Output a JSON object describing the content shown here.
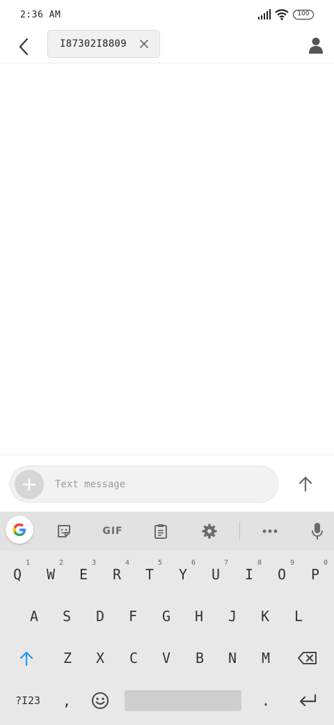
{
  "status_bar": {
    "time": "2:36 AM",
    "battery": "100"
  },
  "header": {
    "recipient": "I87302I8809"
  },
  "compose": {
    "placeholder": "Text message"
  },
  "keyboard": {
    "toolbar": {
      "gif_label": "GIF"
    },
    "row1": [
      {
        "label": "Q",
        "hint": "1"
      },
      {
        "label": "W",
        "hint": "2"
      },
      {
        "label": "E",
        "hint": "3"
      },
      {
        "label": "R",
        "hint": "4"
      },
      {
        "label": "T",
        "hint": "5"
      },
      {
        "label": "Y",
        "hint": "6"
      },
      {
        "label": "U",
        "hint": "7"
      },
      {
        "label": "I",
        "hint": "8"
      },
      {
        "label": "O",
        "hint": "9"
      },
      {
        "label": "P",
        "hint": "0"
      }
    ],
    "row2": [
      "A",
      "S",
      "D",
      "F",
      "G",
      "H",
      "J",
      "K",
      "L"
    ],
    "row3": [
      "Z",
      "X",
      "C",
      "V",
      "B",
      "N",
      "M"
    ],
    "bottom": {
      "symbols": "?I23",
      "comma": ",",
      "period": "."
    }
  },
  "colors": {
    "shift_active": "#2196f3"
  }
}
